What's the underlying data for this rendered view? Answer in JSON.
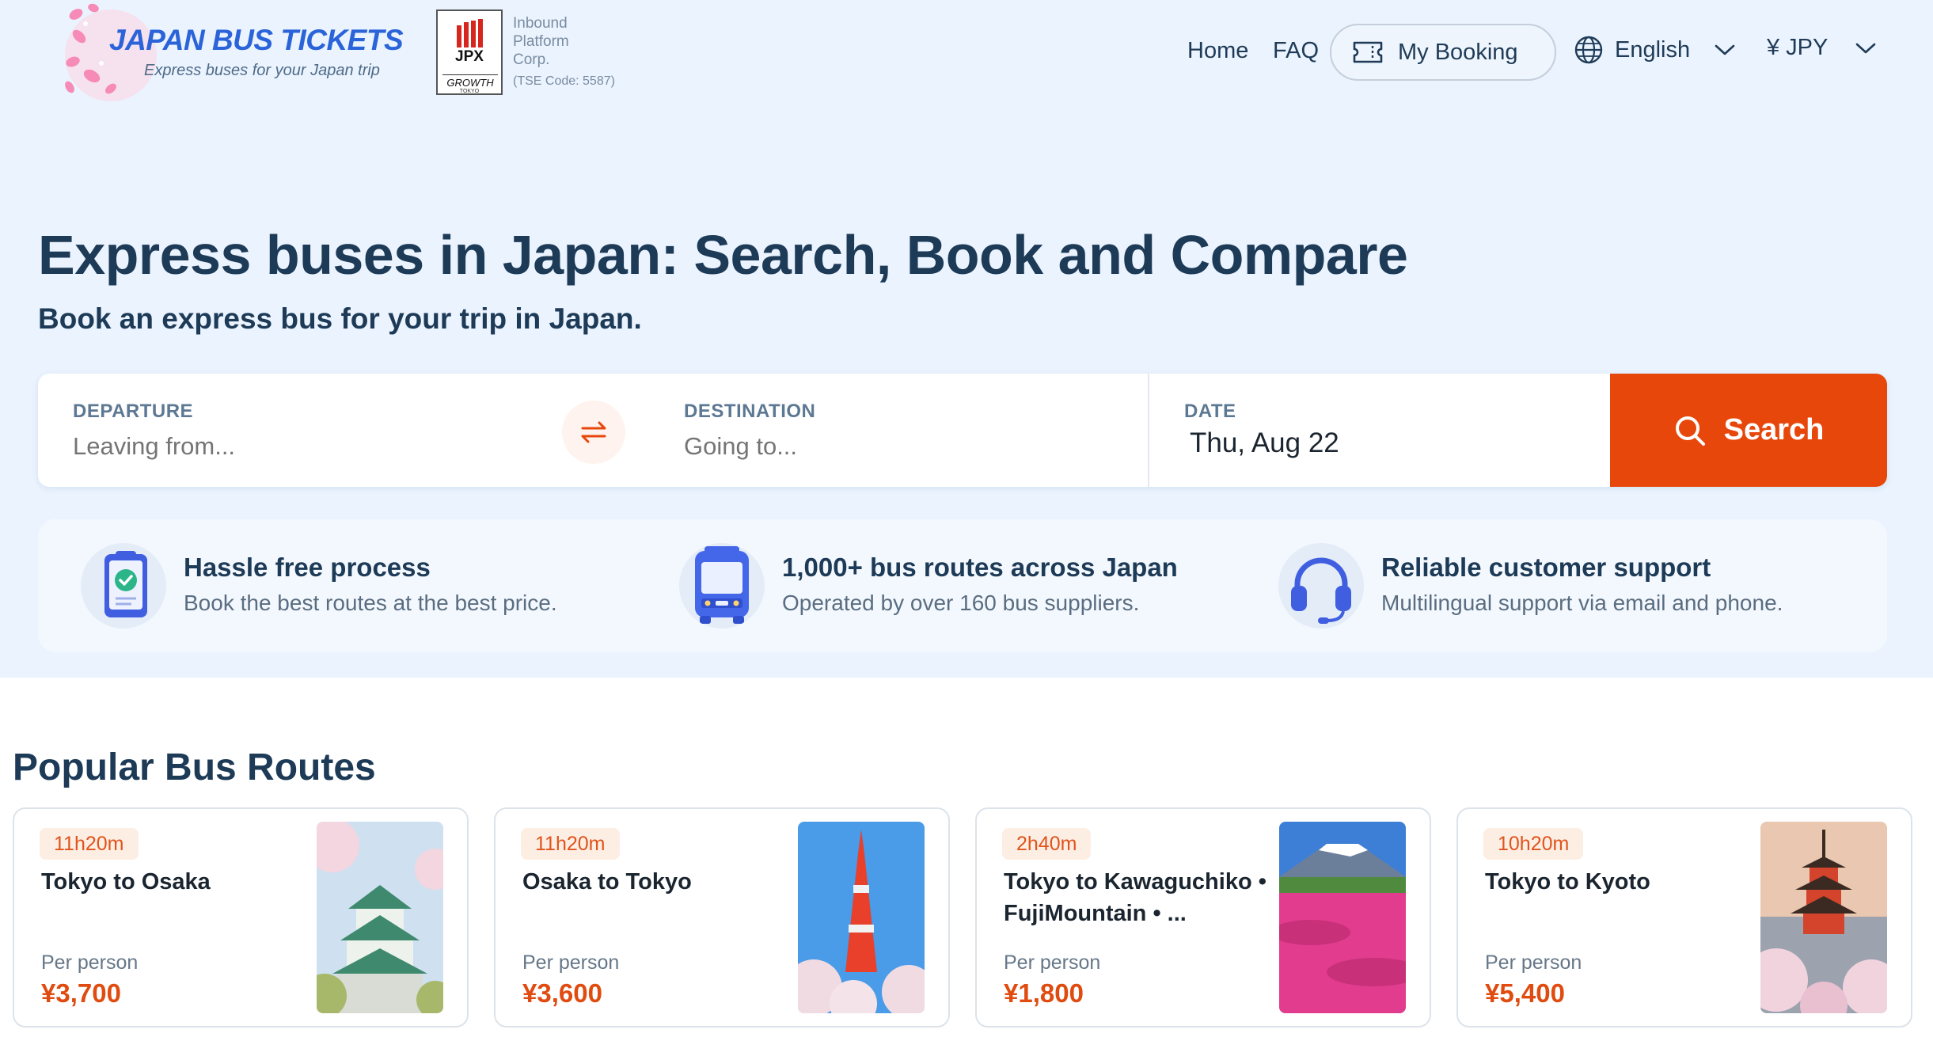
{
  "header": {
    "logo_title": "JAPAN BUS TICKETS",
    "logo_tagline": "Express buses for your Japan trip",
    "jpx_label": "JPX",
    "jpx_growth": "GROWTH",
    "jpx_tokyo": "TOKYO",
    "corp_line1": "Inbound",
    "corp_line2": "Platform",
    "corp_line3": "Corp.",
    "corp_code": "(TSE Code: 5587)",
    "nav": {
      "home": "Home",
      "faq": "FAQ",
      "my_booking": "My Booking",
      "language": "English",
      "currency": "¥ JPY"
    }
  },
  "hero": {
    "title": "Express buses in Japan: Search, Book and Compare",
    "subtitle": "Book an express bus for your trip in Japan."
  },
  "search": {
    "departure_label": "DEPARTURE",
    "departure_placeholder": "Leaving from...",
    "destination_label": "DESTINATION",
    "destination_placeholder": "Going to...",
    "date_label": "DATE",
    "date_value": "Thu, Aug 22",
    "button_label": "Search"
  },
  "features": [
    {
      "icon": "checklist-phone-icon",
      "title": "Hassle free process",
      "desc": "Book the best routes at the best price."
    },
    {
      "icon": "bus-icon",
      "title": "1,000+ bus routes across Japan",
      "desc": "Operated by over 160 bus suppliers."
    },
    {
      "icon": "headset-icon",
      "title": "Reliable customer support",
      "desc": "Multilingual support via email and phone."
    }
  ],
  "popular": {
    "title": "Popular Bus Routes",
    "per_person_label": "Per person",
    "cards": [
      {
        "duration": "11h20m",
        "route": "Tokyo to Osaka",
        "price": "¥3,700",
        "image": "osaka-castle-image"
      },
      {
        "duration": "11h20m",
        "route": "Osaka to Tokyo",
        "price": "¥3,600",
        "image": "tokyo-tower-image"
      },
      {
        "duration": "2h40m",
        "route": "Tokyo to Kawaguchiko • FujiMountain • ...",
        "price": "¥1,800",
        "image": "mount-fuji-image"
      },
      {
        "duration": "10h20m",
        "route": "Tokyo to Kyoto",
        "price": "¥5,400",
        "image": "kyoto-pagoda-image"
      }
    ]
  },
  "colors": {
    "accent": "#e8470c",
    "brand_blue": "#2b63d9",
    "hero_bg": "#eaf3fe",
    "heading": "#1d3a57"
  }
}
